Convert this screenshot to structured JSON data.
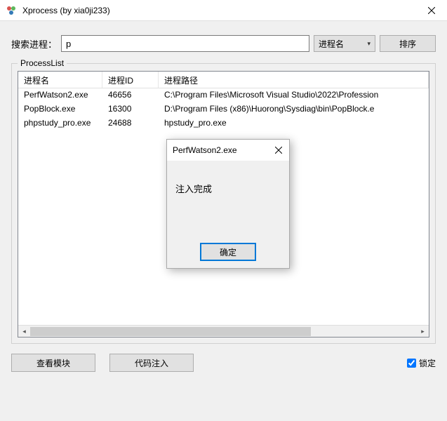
{
  "window": {
    "title": "Xprocess (by xia0ji233)"
  },
  "search": {
    "label": "搜索进程：",
    "value": "p",
    "filter_selected": "进程名",
    "sort_label": "排序"
  },
  "processlist": {
    "legend": "ProcessList",
    "columns": {
      "name": "进程名",
      "id": "进程ID",
      "path": "进程路径"
    },
    "rows": [
      {
        "name": "PerfWatson2.exe",
        "id": "46656",
        "path": "C:\\Program Files\\Microsoft Visual Studio\\2022\\Profession"
      },
      {
        "name": "PopBlock.exe",
        "id": "16300",
        "path": "D:\\Program Files (x86)\\Huorong\\Sysdiag\\bin\\PopBlock.e"
      },
      {
        "name": "phpstudy_pro.exe",
        "id": "24688",
        "path": "hpstudy_pro.exe"
      }
    ]
  },
  "buttons": {
    "view_modules": "查看模块",
    "code_inject": "代码注入",
    "lock_checkbox": "锁定"
  },
  "dialog": {
    "title": "PerfWatson2.exe",
    "message": "注入完成",
    "ok": "确定"
  }
}
